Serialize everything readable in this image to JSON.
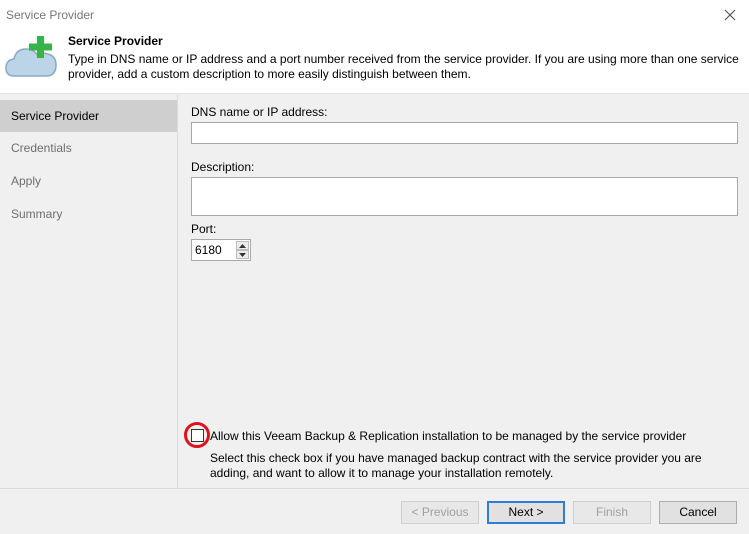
{
  "window": {
    "title": "Service Provider"
  },
  "header": {
    "title": "Service Provider",
    "description": "Type in DNS name or IP address and a port number received from the service provider. If you are using more than one service provider, add a custom description to more easily distinguish between them."
  },
  "sidebar": {
    "items": [
      {
        "label": "Service Provider",
        "active": true
      },
      {
        "label": "Credentials",
        "active": false
      },
      {
        "label": "Apply",
        "active": false
      },
      {
        "label": "Summary",
        "active": false
      }
    ]
  },
  "form": {
    "dns_label": "DNS name or IP address:",
    "dns_value": "",
    "description_label": "Description:",
    "description_value": "",
    "port_label": "Port:",
    "port_value": "6180",
    "checkbox_label": "Allow this Veeam Backup & Replication installation to be managed by the service provider",
    "checkbox_checked": false,
    "checkbox_hint": "Select this check box if you have managed backup contract with the service provider you are adding, and want to allow it to manage your installation remotely."
  },
  "buttons": {
    "previous": "< Previous",
    "next": "Next >",
    "finish": "Finish",
    "cancel": "Cancel"
  },
  "colors": {
    "highlight": "#e0101c",
    "accent": "#2f7dd6",
    "cloud": "#bcd4e8",
    "plus": "#36b34a"
  },
  "icons": {
    "close": "close-icon",
    "logo": "cloud-plus-icon",
    "spin_up": "chevron-up-icon",
    "spin_down": "chevron-down-icon"
  }
}
